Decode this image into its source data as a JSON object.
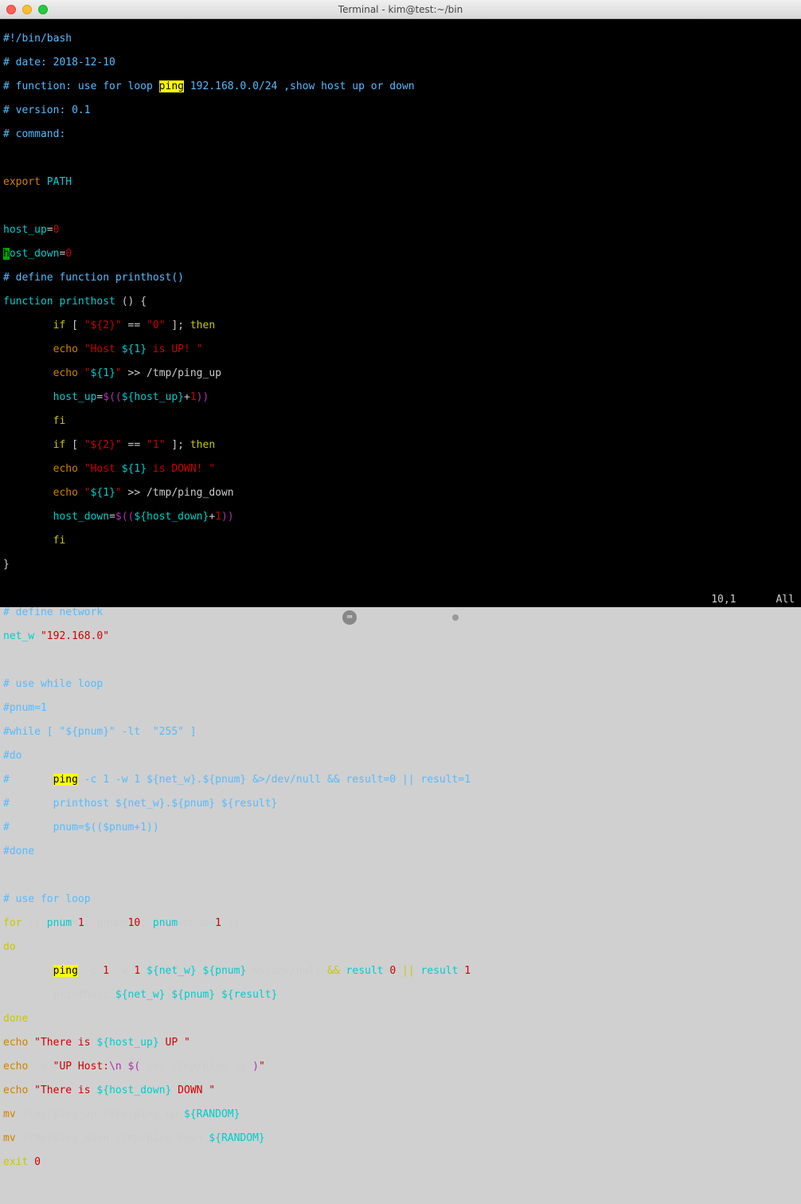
{
  "window": {
    "title": "Terminal - kim@test:~/bin"
  },
  "status": {
    "position": "10,1",
    "scroll": "All"
  },
  "code": {
    "l01_a": "#!/bin/bash",
    "l02_a": "# date: 2018-12-10",
    "l03_a": "# function: use for loop ",
    "l03_hl": "ping",
    "l03_b": " 192.168.0.0/24 ,show host up or down",
    "l04_a": "# version: 0.1",
    "l05_a": "# command:",
    "l07_kw": "export",
    "l07_var": " PATH",
    "l09_var": "host_up",
    "l09_eq": "=",
    "l09_val": "0",
    "l10_cur": "h",
    "l10_var": "ost_down",
    "l10_eq": "=",
    "l10_val": "0",
    "l11_a": "# define function printhost()",
    "l12_kw": "function",
    "l12_name": " printhost ",
    "l12_par": "()",
    "l12_brace": " {",
    "l13_pad": "        ",
    "l13_if": "if",
    "l13_a": " [ ",
    "l13_str": "\"${2}\"",
    "l13_b": " == ",
    "l13_str2": "\"0\"",
    "l13_c": " ]; ",
    "l13_then": "then",
    "l14_pad": "        ",
    "l14_echo": "echo",
    "l14_sp": " ",
    "l14_q1": "\"Host ",
    "l14_v": "${1}",
    "l14_q2": " is UP! \"",
    "l15_pad": "        ",
    "l15_echo": "echo",
    "l15_sp": " ",
    "l15_q1": "\"",
    "l15_v": "${1}",
    "l15_q2": "\"",
    "l15_redir": " >> ",
    "l15_path": "/tmp/ping_up",
    "l16_pad": "        ",
    "l16_var": "host_up",
    "l16_eq": "=",
    "l16_a": "$((",
    "l16_v": "${host_up}",
    "l16_b": "+",
    "l16_num": "1",
    "l16_c": "))",
    "l17_pad": "        ",
    "l17_fi": "fi",
    "l18_pad": "        ",
    "l18_if": "if",
    "l18_a": " [ ",
    "l18_str": "\"${2}\"",
    "l18_b": " == ",
    "l18_str2": "\"1\"",
    "l18_c": " ]; ",
    "l18_then": "then",
    "l19_pad": "        ",
    "l19_echo": "echo",
    "l19_sp": " ",
    "l19_q1": "\"Host ",
    "l19_v": "${1}",
    "l19_q2": " is DOWN! \"",
    "l20_pad": "        ",
    "l20_echo": "echo",
    "l20_sp": " ",
    "l20_q1": "\"",
    "l20_v": "${1}",
    "l20_q2": "\"",
    "l20_redir": " >> ",
    "l20_path": "/tmp/ping_down",
    "l21_pad": "        ",
    "l21_var": "host_down",
    "l21_eq": "=",
    "l21_a": "$((",
    "l21_v": "${host_down}",
    "l21_b": "+",
    "l21_num": "1",
    "l21_c": "))",
    "l22_pad": "        ",
    "l22_fi": "fi",
    "l23_brace": "}",
    "l25_a": "# define network",
    "l26_var": "net_w",
    "l26_eq": "=",
    "l26_str": "\"192.168.0\"",
    "l28_a": "# use while loop",
    "l29_a": "#pnum=1",
    "l30_a": "#while [ \"${pnum}\" -lt  \"255\" ]",
    "l31_a": "#do",
    "l32_a": "#       ",
    "l32_hl": "ping",
    "l32_b": " -c 1 -w 1 ${net_w}.${pnum} &>/dev/null && result=0 || result=1",
    "l33_a": "#       printhost ${net_w}.${pnum} ${result}",
    "l34_a": "#       pnum=$(($pnum+1))",
    "l35_a": "#done",
    "l37_a": "# use for loop",
    "l38_for": "for",
    "l38_a": " (( ",
    "l38_v1": "pnum",
    "l38_eq1": "=",
    "l38_n1": "1",
    "l38_sc1": "; ",
    "l38_v2": "pnum<",
    "l38_n2": "10",
    "l38_sc2": "; ",
    "l38_v3": "pnum",
    "l38_eq2": "=",
    "l38_v4": "pnum+",
    "l38_n3": "1",
    "l38_b": " ))",
    "l39_do": "do",
    "l40_pad": "        ",
    "l40_hl": "ping",
    "l40_flags": " -c ",
    "l40_n1": "1",
    "l40_w": " -w ",
    "l40_n2": "1",
    "l40_sp": " ",
    "l40_v1": "${net_w}",
    "l40_dot": ".",
    "l40_v2": "${pnum}",
    "l40_redir": " &>",
    "l40_null": "/dev/null ",
    "l40_and": "&&",
    "l40_sp2": " ",
    "l40_r1": "result",
    "l40_eq1": "=",
    "l40_rn1": "0",
    "l40_or": " || ",
    "l40_r2": "result",
    "l40_eq2": "=",
    "l40_rn2": "1",
    "l41_pad": "        printhost ",
    "l41_v1": "${net_w}",
    "l41_dot": ".",
    "l41_v2": "${pnum}",
    "l41_sp": " ",
    "l41_v3": "${result}",
    "l42_done": "done",
    "l43_echo": "echo",
    "l43_sp": " ",
    "l43_q1": "\"There is ",
    "l43_v": "${host_up}",
    "l43_q2": " UP \"",
    "l44_echo": "echo",
    "l44_flag": " -e ",
    "l44_q1": "\"UP Host:",
    "l44_esc": "\\n",
    "l44_sp": " ",
    "l44_sub": "$(",
    "l44_cat": " cat /tmp/ping_up ",
    "l44_sub2": ")",
    "l44_q2": "\"",
    "l45_echo": "echo",
    "l45_sp": " ",
    "l45_q1": "\"There is ",
    "l45_v": "${host_down}",
    "l45_q2": " DOWN \"",
    "l46_mv": "mv",
    "l46_a": " /tmp/ping_up /tmp/ping_up.",
    "l46_v": "${RANDOM}",
    "l47_mv": "mv",
    "l47_a": " /tmp/ping_down /tmp/ping_down.",
    "l47_v": "${RANDOM}",
    "l48_exit": "exit",
    "l48_sp": " ",
    "l48_n": "0"
  }
}
